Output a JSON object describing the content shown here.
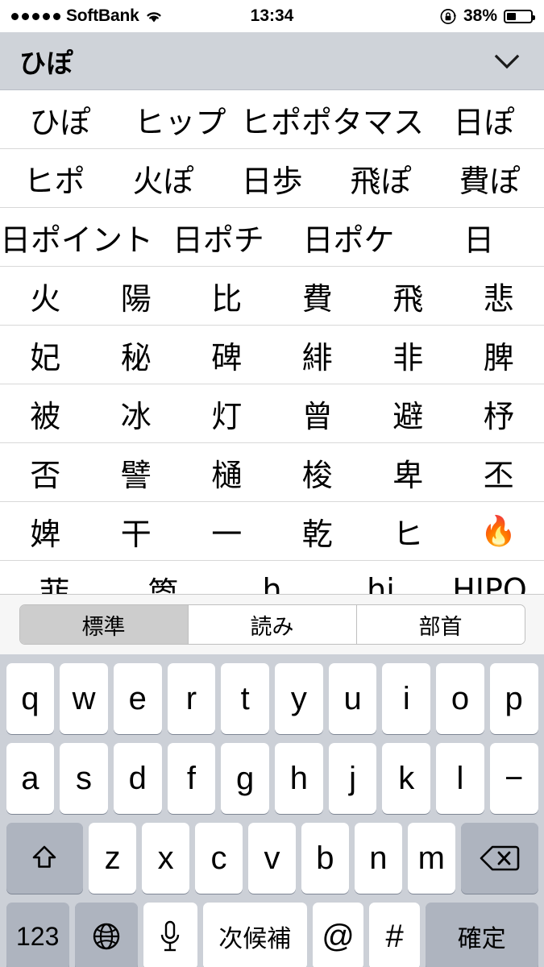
{
  "status_bar": {
    "signal_dots": 5,
    "carrier": "SoftBank",
    "wifi_icon": "wifi-icon",
    "time": "13:34",
    "rotation_lock_icon": "rotation-lock-icon",
    "battery_percent": "38%",
    "battery_level": 38
  },
  "candidate_header": {
    "reading": "ひぽ",
    "collapse_icon": "chevron-down-icon"
  },
  "candidates": {
    "rows": [
      [
        "ひぽ",
        "ヒップ",
        "ヒポポタマス",
        "日ぽ"
      ],
      [
        "ヒポ",
        "火ぽ",
        "日歩",
        "飛ぽ",
        "費ぽ"
      ],
      [
        "日ポイント",
        "日ポチ",
        "日ポケ",
        "日"
      ],
      [
        "火",
        "陽",
        "比",
        "費",
        "飛",
        "悲"
      ],
      [
        "妃",
        "秘",
        "碑",
        "緋",
        "非",
        "脾"
      ],
      [
        "被",
        "冰",
        "灯",
        "曾",
        "避",
        "杼"
      ],
      [
        "否",
        "譬",
        "樋",
        "梭",
        "卑",
        "丕"
      ],
      [
        "婢",
        "干",
        "一",
        "乾",
        "ヒ",
        "🔥"
      ],
      [
        "菲",
        "箆",
        "h",
        "hi",
        "HIPO"
      ]
    ]
  },
  "segmented_control": {
    "options": [
      "標準",
      "読み",
      "部首"
    ],
    "selected_index": 0
  },
  "keyboard": {
    "row1": [
      "q",
      "w",
      "e",
      "r",
      "t",
      "y",
      "u",
      "i",
      "o",
      "p"
    ],
    "row2": [
      "a",
      "s",
      "d",
      "f",
      "g",
      "h",
      "j",
      "k",
      "l",
      "−"
    ],
    "row3": {
      "shift_icon": "shift-arrow-icon",
      "letters": [
        "z",
        "x",
        "c",
        "v",
        "b",
        "n",
        "m"
      ],
      "delete_icon": "backspace-icon"
    },
    "row4": {
      "numeric_label": "123",
      "globe_icon": "globe-icon",
      "mic_icon": "microphone-icon",
      "next_candidate_label": "次候補",
      "at_label": "@",
      "hash_label": "#",
      "confirm_label": "確定"
    }
  },
  "colors": {
    "keyboard_background": "#ccd0d7",
    "key_light": "#ffffff",
    "key_dark": "#aeb4bf",
    "header_background": "#cfd3d9",
    "segment_selected": "#cdcdcd"
  }
}
